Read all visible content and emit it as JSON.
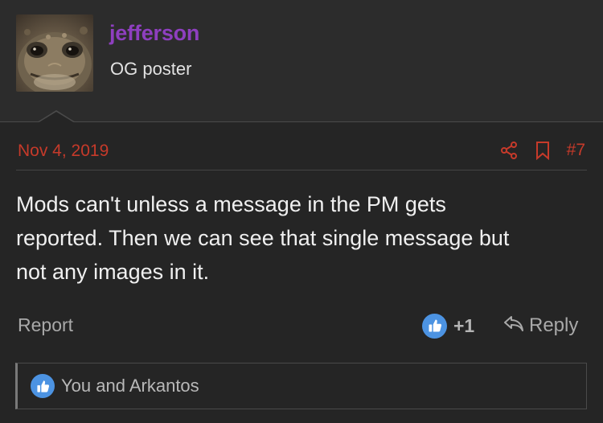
{
  "user": {
    "name": "jefferson",
    "title": "OG poster",
    "avatar_desc_icon": "toad-avatar"
  },
  "post": {
    "date": "Nov 4, 2019",
    "number": "#7",
    "body": "Mods can't unless a message in the PM gets\nreported. Then we can see that single message but\nnot any images in it.",
    "report_label": "Report",
    "like_count": "+1",
    "reply_label": "Reply",
    "reactions_text": "You and Arkantos"
  },
  "colors": {
    "username": "#8e3fbf",
    "accent_red": "#c63a2a",
    "like_blue": "#4c93e2",
    "background": "#252525"
  }
}
